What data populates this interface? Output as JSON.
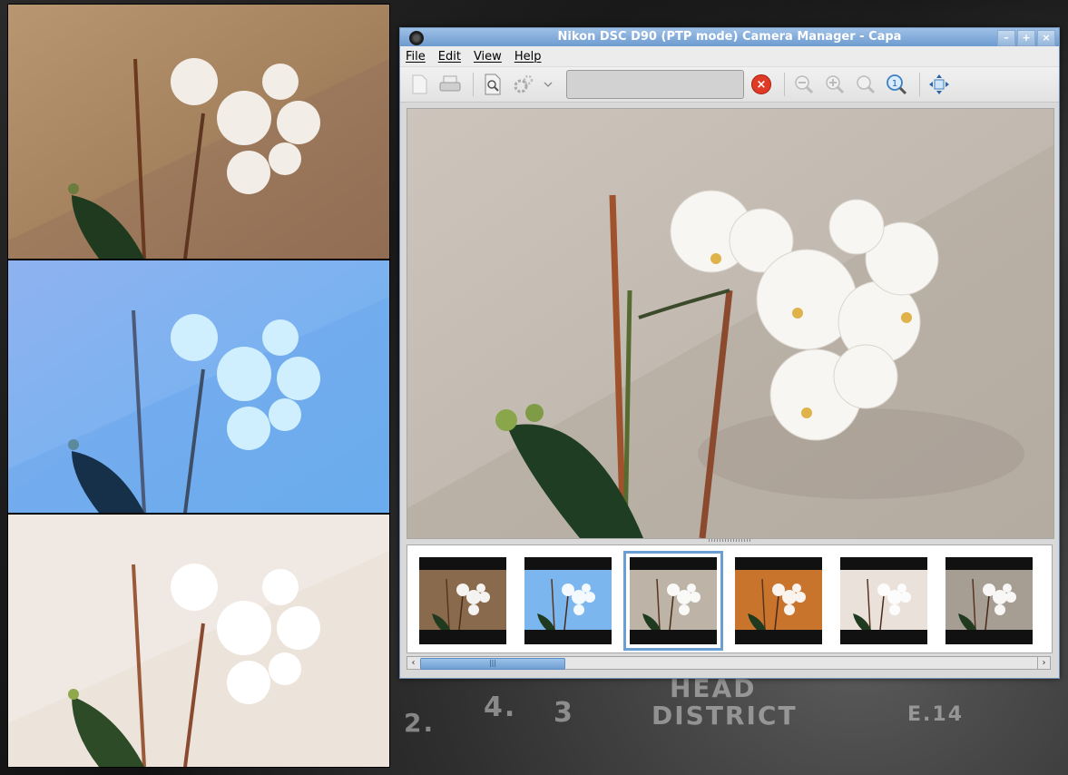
{
  "window": {
    "title": "Nikon DSC D90 (PTP mode) Camera Manager - Capa",
    "minimize_label": "–",
    "maximize_label": "+",
    "close_label": "×"
  },
  "menubar": {
    "items": [
      "File",
      "Edit",
      "View",
      "Help"
    ]
  },
  "toolbar": {
    "search_value": "",
    "clear_symbol": "×",
    "icons": [
      "new-file-icon",
      "print-icon",
      "preview-icon",
      "settings-icon",
      "dropdown-icon",
      "zoom-out-icon",
      "zoom-in-icon",
      "zoom-fit-icon",
      "zoom-100-icon",
      "fit-window-icon"
    ]
  },
  "thumbnails": {
    "tints": [
      "#8a6a4c",
      "#7bb6ee",
      "#bdb3a7",
      "#c9742c",
      "#eae2da",
      "#a69d93"
    ],
    "selected_index": 2
  },
  "scrollbar": {
    "left_arrow": "‹",
    "right_arrow": "›",
    "grip": "|||",
    "position_fraction": 0.0
  },
  "desktop": {
    "map_labels": [
      "HEAD",
      "DISTRICT",
      "4.",
      "3",
      "2.",
      "E.14"
    ]
  },
  "left_photos": {
    "tints": [
      "#9b7b5c",
      "#7bb3ef",
      "#f2ebe5"
    ]
  }
}
